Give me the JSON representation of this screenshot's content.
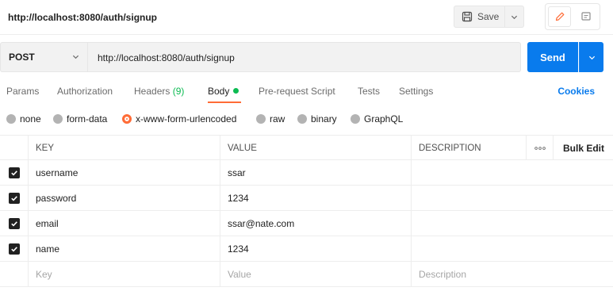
{
  "request": {
    "title": "http://localhost:8080/auth/signup",
    "method": "POST",
    "url": "http://localhost:8080/auth/signup"
  },
  "toolbar": {
    "save_label": "Save",
    "send_label": "Send"
  },
  "tabs": {
    "params": "Params",
    "authorization": "Authorization",
    "headers": "Headers",
    "headers_count": "(9)",
    "body": "Body",
    "pre_request": "Pre-request Script",
    "tests": "Tests",
    "settings": "Settings",
    "cookies": "Cookies",
    "active": "Body"
  },
  "body_types": {
    "none": "none",
    "form_data": "form-data",
    "urlencoded": "x-www-form-urlencoded",
    "raw": "raw",
    "binary": "binary",
    "graphql": "GraphQL",
    "selected": "x-www-form-urlencoded"
  },
  "table": {
    "columns": {
      "key": "KEY",
      "value": "VALUE",
      "description": "DESCRIPTION",
      "bulk_edit": "Bulk Edit"
    },
    "rows": [
      {
        "key": "username",
        "value": "ssar",
        "description": "",
        "checked": true
      },
      {
        "key": "password",
        "value": "1234",
        "description": "",
        "checked": true
      },
      {
        "key": "email",
        "value": "ssar@nate.com",
        "description": "",
        "checked": true
      },
      {
        "key": "name",
        "value": "1234",
        "description": "",
        "checked": true
      }
    ],
    "placeholders": {
      "key": "Key",
      "value": "Value",
      "description": "Description"
    }
  },
  "colors": {
    "accent_blue": "#097bed",
    "accent_orange": "#ff6c37",
    "status_green": "#0cbb52"
  }
}
